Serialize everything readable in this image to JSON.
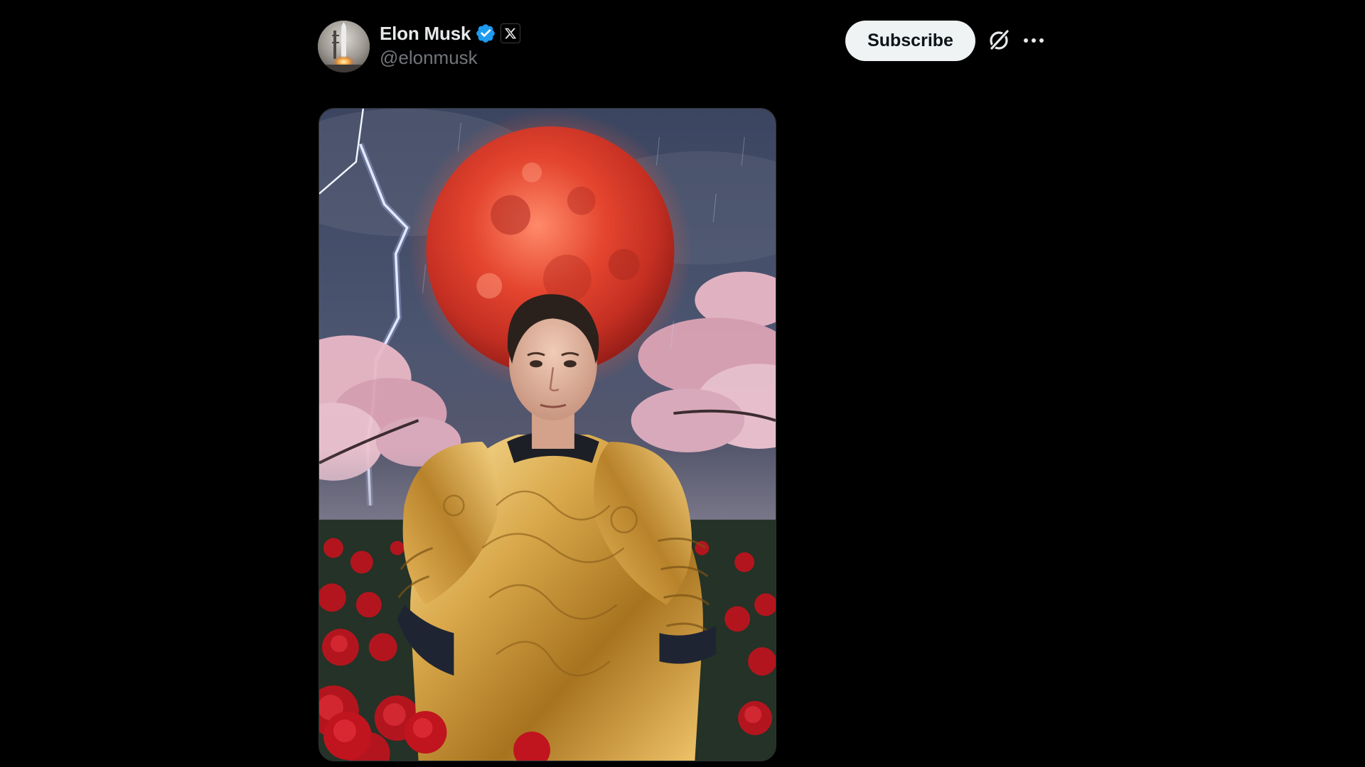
{
  "post": {
    "author": {
      "display_name": "Elon Musk",
      "handle": "@elonmusk",
      "verified": true,
      "affiliate_badge_icon": "x-logo-icon",
      "avatar_icon": "rocket-launch-avatar"
    },
    "actions": {
      "subscribe_label": "Subscribe",
      "grok_icon": "grok-icon",
      "more_icon": "more-horizontal-icon"
    },
    "media": {
      "type": "image"
    }
  },
  "colors": {
    "background": "#000000",
    "primary_text": "#e7e9ea",
    "secondary_text": "#71767b",
    "verified_blue": "#1d9bf0",
    "subscribe_bg": "#eff3f4",
    "subscribe_text": "#0f1419"
  }
}
